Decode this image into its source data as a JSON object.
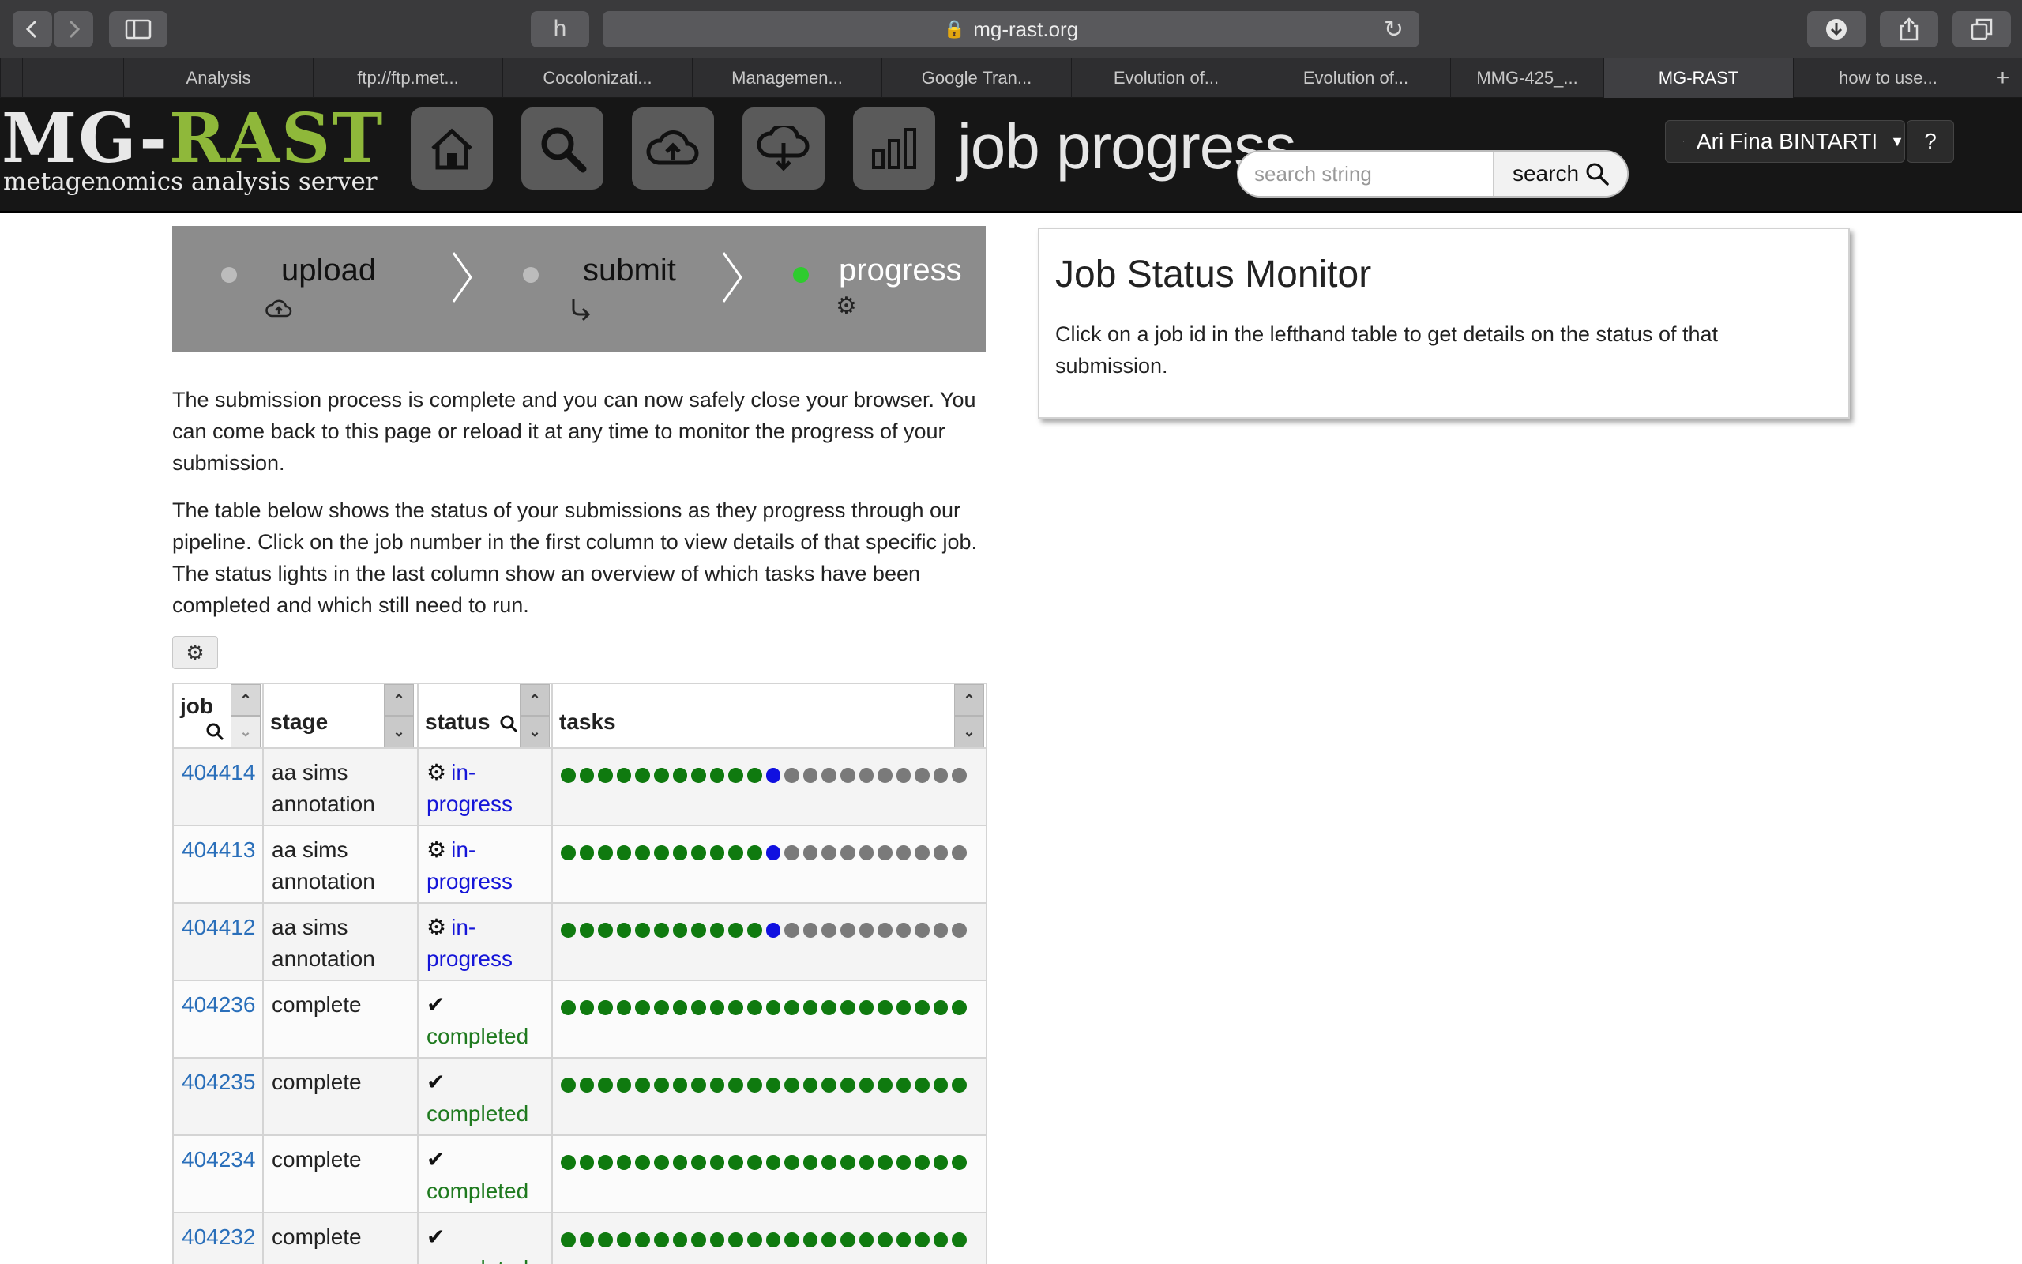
{
  "browser": {
    "url": "mg-rast.org",
    "tabs": [
      {
        "label": "Analysis",
        "active": false
      },
      {
        "label": "ftp://ftp.met...",
        "active": false
      },
      {
        "label": "Cocolonizati...",
        "active": false
      },
      {
        "label": "Managemen...",
        "active": false
      },
      {
        "label": "Google Tran...",
        "active": false
      },
      {
        "label": "Evolution of...",
        "active": false
      },
      {
        "label": "Evolution of...",
        "active": false
      },
      {
        "label": "MMG-425_...",
        "active": false
      },
      {
        "label": "MG-RAST",
        "active": true
      },
      {
        "label": "how to use...",
        "active": false
      }
    ],
    "icons": [
      "back-icon",
      "forward-icon",
      "sidebar-icon",
      "extension-icon",
      "lock-icon",
      "reload-icon",
      "download-icon",
      "share-icon",
      "tabs-overview-icon",
      "new-tab-icon"
    ]
  },
  "header": {
    "logo_main_1": "MG-",
    "logo_main_2": "RAST",
    "logo_sub": "metagenomics analysis server",
    "nav": [
      "home-icon",
      "search-icon",
      "upload-cloud-icon",
      "download-cloud-icon",
      "bar-chart-icon"
    ],
    "page_title": "job progress",
    "search_placeholder": "search string",
    "search_button": "search",
    "user_name": "Ari Fina BINTARTI",
    "help": "?"
  },
  "stepper": {
    "steps": [
      {
        "label": "upload",
        "icon": "upload-icon",
        "active": false
      },
      {
        "label": "submit",
        "icon": "submit-arrow-icon",
        "active": false
      },
      {
        "label": "progress",
        "icon": "gears-icon",
        "active": true
      }
    ],
    "active_dot_color": "#2ecc2e",
    "inactive_dot_color": "#bcbcbc"
  },
  "intro": {
    "p1": "The submission process is complete and you can now safely close your browser. You can come back to this page or reload it at any time to monitor the progress of your submission.",
    "p2": "The table below shows the status of your submissions as they progress through our pipeline. Click on the job number in the first column to view details of that specific job. The status lights in the last column show an overview of which tasks have been completed and which still need to run."
  },
  "table": {
    "headers": {
      "job": "job",
      "stage": "stage",
      "status": "status",
      "tasks": "tasks"
    },
    "colors": {
      "done": "#0f7a0f",
      "running": "#1010e0",
      "pending": "#7a7a7a"
    },
    "rows": [
      {
        "job": "404414",
        "stage": "aa sims annotation",
        "status_kind": "in-progress",
        "status_a": "in-",
        "status_b": "progress",
        "tasks_done": 11,
        "tasks_running": 1,
        "tasks_total": 22
      },
      {
        "job": "404413",
        "stage": "aa sims annotation",
        "status_kind": "in-progress",
        "status_a": "in-",
        "status_b": "progress",
        "tasks_done": 11,
        "tasks_running": 1,
        "tasks_total": 22
      },
      {
        "job": "404412",
        "stage": "aa sims annotation",
        "status_kind": "in-progress",
        "status_a": "in-",
        "status_b": "progress",
        "tasks_done": 11,
        "tasks_running": 1,
        "tasks_total": 22
      },
      {
        "job": "404236",
        "stage": "complete",
        "status_kind": "completed",
        "status_a": "",
        "status_b": "completed",
        "tasks_done": 22,
        "tasks_running": 0,
        "tasks_total": 22
      },
      {
        "job": "404235",
        "stage": "complete",
        "status_kind": "completed",
        "status_a": "",
        "status_b": "completed",
        "tasks_done": 22,
        "tasks_running": 0,
        "tasks_total": 22
      },
      {
        "job": "404234",
        "stage": "complete",
        "status_kind": "completed",
        "status_a": "",
        "status_b": "completed",
        "tasks_done": 22,
        "tasks_running": 0,
        "tasks_total": 22
      },
      {
        "job": "404232",
        "stage": "complete",
        "status_kind": "completed",
        "status_a": "",
        "status_b": "completed",
        "tasks_done": 22,
        "tasks_running": 0,
        "tasks_total": 22
      }
    ]
  },
  "monitor": {
    "title": "Job Status Monitor",
    "text": "Click on a job id in the lefthand table to get details on the status of that submission."
  }
}
